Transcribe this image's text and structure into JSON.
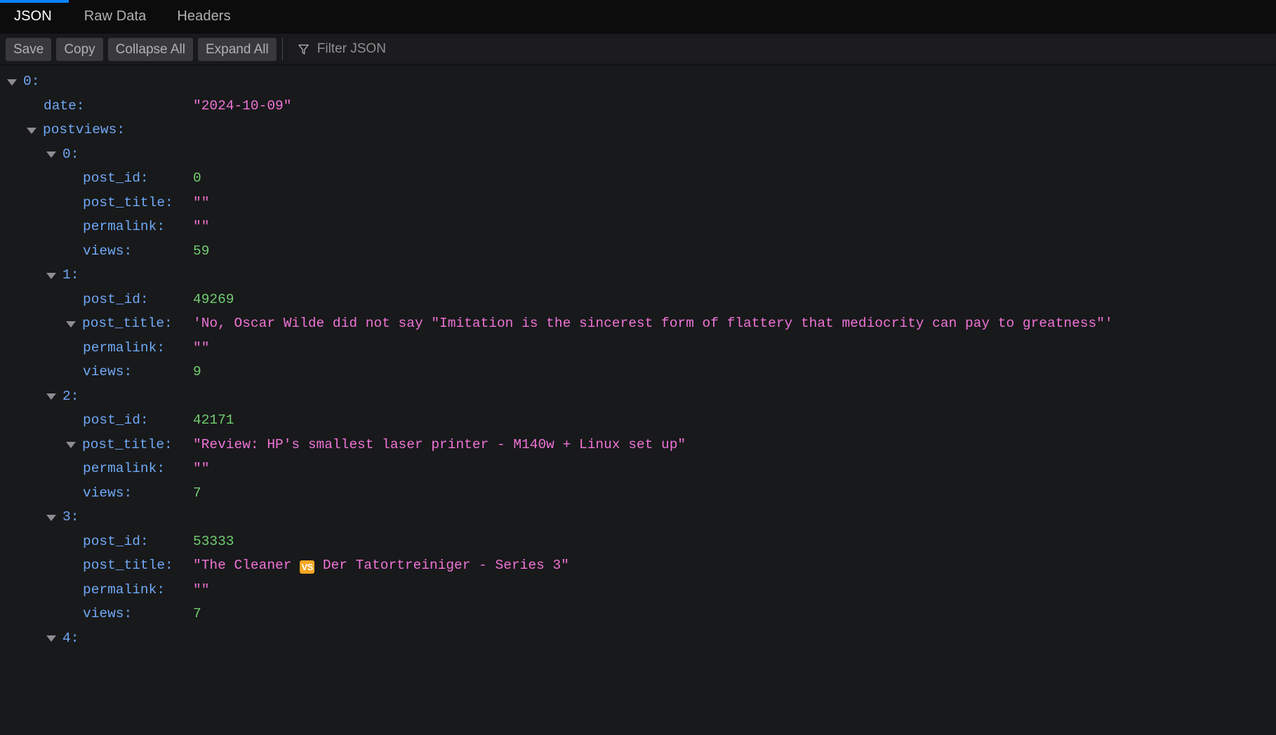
{
  "tabs": [
    {
      "id": "json",
      "label": "JSON",
      "active": true
    },
    {
      "id": "raw-data",
      "label": "Raw Data",
      "active": false
    },
    {
      "id": "headers",
      "label": "Headers",
      "active": false
    }
  ],
  "toolbar": {
    "save_label": "Save",
    "copy_label": "Copy",
    "collapse_all_label": "Collapse All",
    "expand_all_label": "Expand All",
    "filter_placeholder": "Filter JSON",
    "filter_value": "",
    "filter_icon": "funnel-icon"
  },
  "colors": {
    "background": "#18191a",
    "tabbar_background": "#0c0c0d",
    "active_tab_accent": "#0a84ff",
    "key": "#6fa8f5",
    "string": "#ef73d8",
    "number": "#71cc71",
    "twisty": "#8d8d8f",
    "button": "#38383d",
    "button_text": "#b1b1b3",
    "emoji_badge": "#f5a623"
  },
  "json_rows": [
    {
      "id": "r0",
      "indent": 0,
      "twisty": true,
      "key": "0:",
      "value": "",
      "type": "none"
    },
    {
      "id": "r1",
      "indent": 1,
      "twisty": false,
      "key": "date:",
      "value": "\"2024-10-09\"",
      "type": "string"
    },
    {
      "id": "r2",
      "indent": 1,
      "twisty": true,
      "key": "postviews:",
      "value": "",
      "type": "none"
    },
    {
      "id": "r3",
      "indent": 2,
      "twisty": true,
      "key": "0:",
      "value": "",
      "type": "none"
    },
    {
      "id": "r4",
      "indent": 3,
      "twisty": false,
      "key": "post_id:",
      "value": "0",
      "type": "number"
    },
    {
      "id": "r5",
      "indent": 3,
      "twisty": false,
      "key": "post_title:",
      "value": "\"\"",
      "type": "string"
    },
    {
      "id": "r6",
      "indent": 3,
      "twisty": false,
      "key": "permalink:",
      "value": "\"\"",
      "type": "string"
    },
    {
      "id": "r7",
      "indent": 3,
      "twisty": false,
      "key": "views:",
      "value": "59",
      "type": "number"
    },
    {
      "id": "r8",
      "indent": 2,
      "twisty": true,
      "key": "1:",
      "value": "",
      "type": "none"
    },
    {
      "id": "r9",
      "indent": 3,
      "twisty": false,
      "key": "post_id:",
      "value": "49269",
      "type": "number"
    },
    {
      "id": "r10",
      "indent": 3,
      "twisty": true,
      "key": "post_title:",
      "value": "'No, Oscar Wilde did not say \"Imitation is the sincerest form of flattery that mediocrity can pay to greatness\"'",
      "type": "string"
    },
    {
      "id": "r11",
      "indent": 3,
      "twisty": false,
      "key": "permalink:",
      "value": "\"\"",
      "type": "string"
    },
    {
      "id": "r12",
      "indent": 3,
      "twisty": false,
      "key": "views:",
      "value": "9",
      "type": "number"
    },
    {
      "id": "r13",
      "indent": 2,
      "twisty": true,
      "key": "2:",
      "value": "",
      "type": "none"
    },
    {
      "id": "r14",
      "indent": 3,
      "twisty": false,
      "key": "post_id:",
      "value": "42171",
      "type": "number"
    },
    {
      "id": "r15",
      "indent": 3,
      "twisty": true,
      "key": "post_title:",
      "value": "\"Review: HP's smallest laser printer - M140w + Linux set up\"",
      "type": "string"
    },
    {
      "id": "r16",
      "indent": 3,
      "twisty": false,
      "key": "permalink:",
      "value": "\"\"",
      "type": "string"
    },
    {
      "id": "r17",
      "indent": 3,
      "twisty": false,
      "key": "views:",
      "value": "7",
      "type": "number"
    },
    {
      "id": "r18",
      "indent": 2,
      "twisty": true,
      "key": "3:",
      "value": "",
      "type": "none"
    },
    {
      "id": "r19",
      "indent": 3,
      "twisty": false,
      "key": "post_id:",
      "value": "53333",
      "type": "number"
    },
    {
      "id": "r20",
      "indent": 3,
      "twisty": false,
      "key": "post_title:",
      "value": "\"The Cleaner 🆚 Der Tatortreiniger - Series 3\"",
      "type": "string",
      "emoji": "VS"
    },
    {
      "id": "r21",
      "indent": 3,
      "twisty": false,
      "key": "permalink:",
      "value": "\"\"",
      "type": "string"
    },
    {
      "id": "r22",
      "indent": 3,
      "twisty": false,
      "key": "views:",
      "value": "7",
      "type": "number"
    },
    {
      "id": "r23",
      "indent": 2,
      "twisty": true,
      "key": "4:",
      "value": "",
      "type": "none"
    }
  ]
}
